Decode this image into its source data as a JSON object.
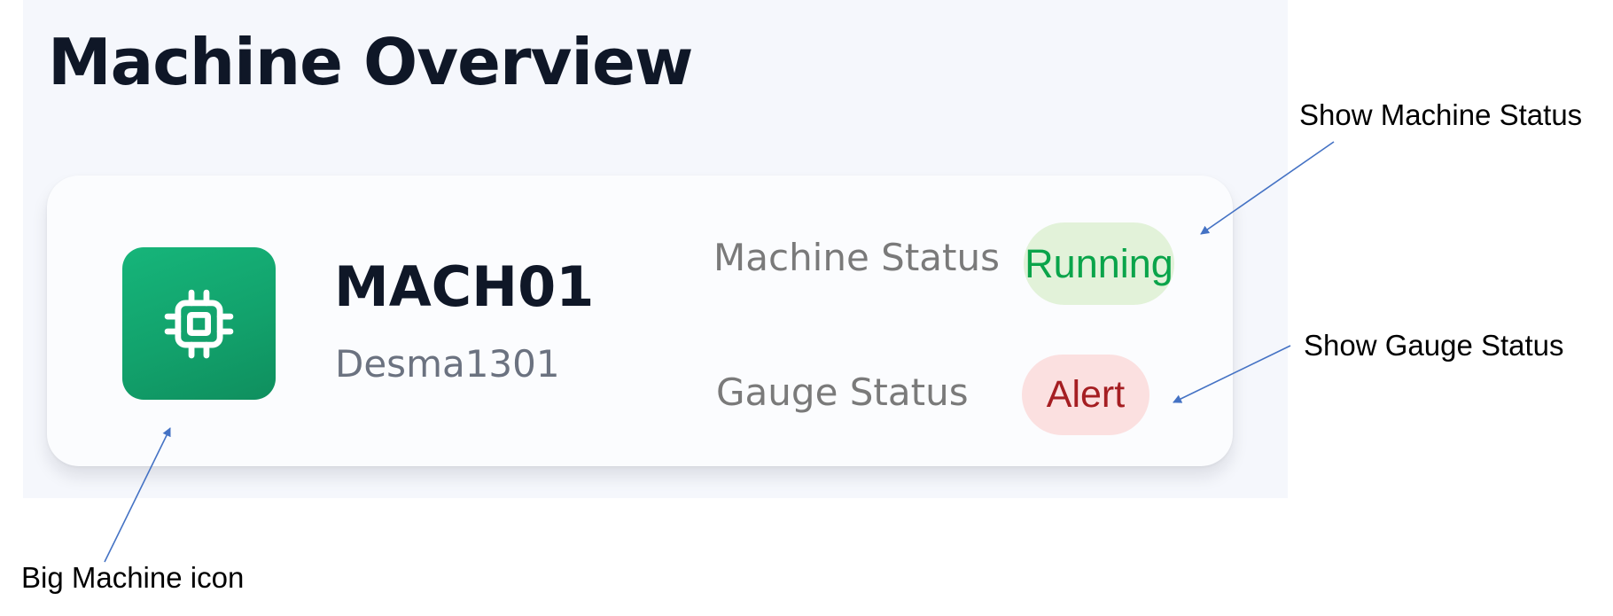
{
  "page": {
    "title": "Machine Overview"
  },
  "machine": {
    "id": "MACH01",
    "model": "Desma1301",
    "icon": "cpu-chip-icon"
  },
  "statuses": {
    "machine": {
      "label": "Machine Status",
      "value": "Running",
      "badge_bg": "#e2f2d9",
      "badge_color": "#0aa44a"
    },
    "gauge": {
      "label": "Gauge Status",
      "value": "Alert",
      "badge_bg": "#fbe0e0",
      "badge_color": "#a51e22"
    }
  },
  "annotations": {
    "machine_status": "Show Machine Status",
    "gauge_status": "Show Gauge Status",
    "big_icon": "Big Machine icon"
  },
  "colors": {
    "icon_tile": "#12a26c",
    "title_text": "#0f1727",
    "annotation_arrow": "#4472c4"
  }
}
